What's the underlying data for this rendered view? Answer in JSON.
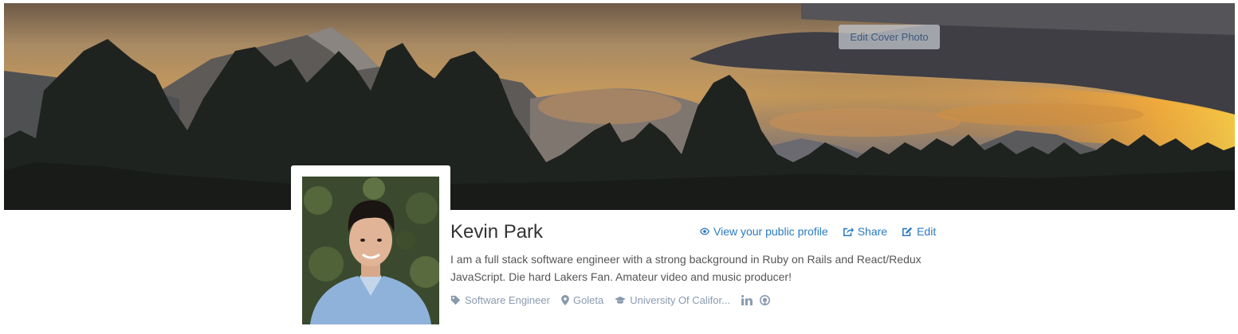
{
  "cover": {
    "edit_button_label": "Edit Cover Photo"
  },
  "profile": {
    "name": "Kevin Park",
    "bio": "I am a full stack software engineer with a strong background in Ruby on Rails and React/Redux JavaScript. Die hard Lakers Fan. Amateur video and music producer!"
  },
  "actions": {
    "view_public_profile": "View your public profile",
    "share": "Share",
    "edit": "Edit"
  },
  "meta": {
    "occupation": "Software Engineer",
    "location": "Goleta",
    "education": "University Of Califor..."
  },
  "icons": {
    "view_profile": "eye-icon",
    "share": "share-icon",
    "edit": "edit-icon",
    "occupation": "tag-icon",
    "location": "map-marker-icon",
    "education": "graduation-cap-icon",
    "linkedin": "linkedin-icon",
    "github": "github-icon"
  },
  "colors": {
    "link": "#2a7ac0",
    "meta": "#8a9bb0"
  }
}
